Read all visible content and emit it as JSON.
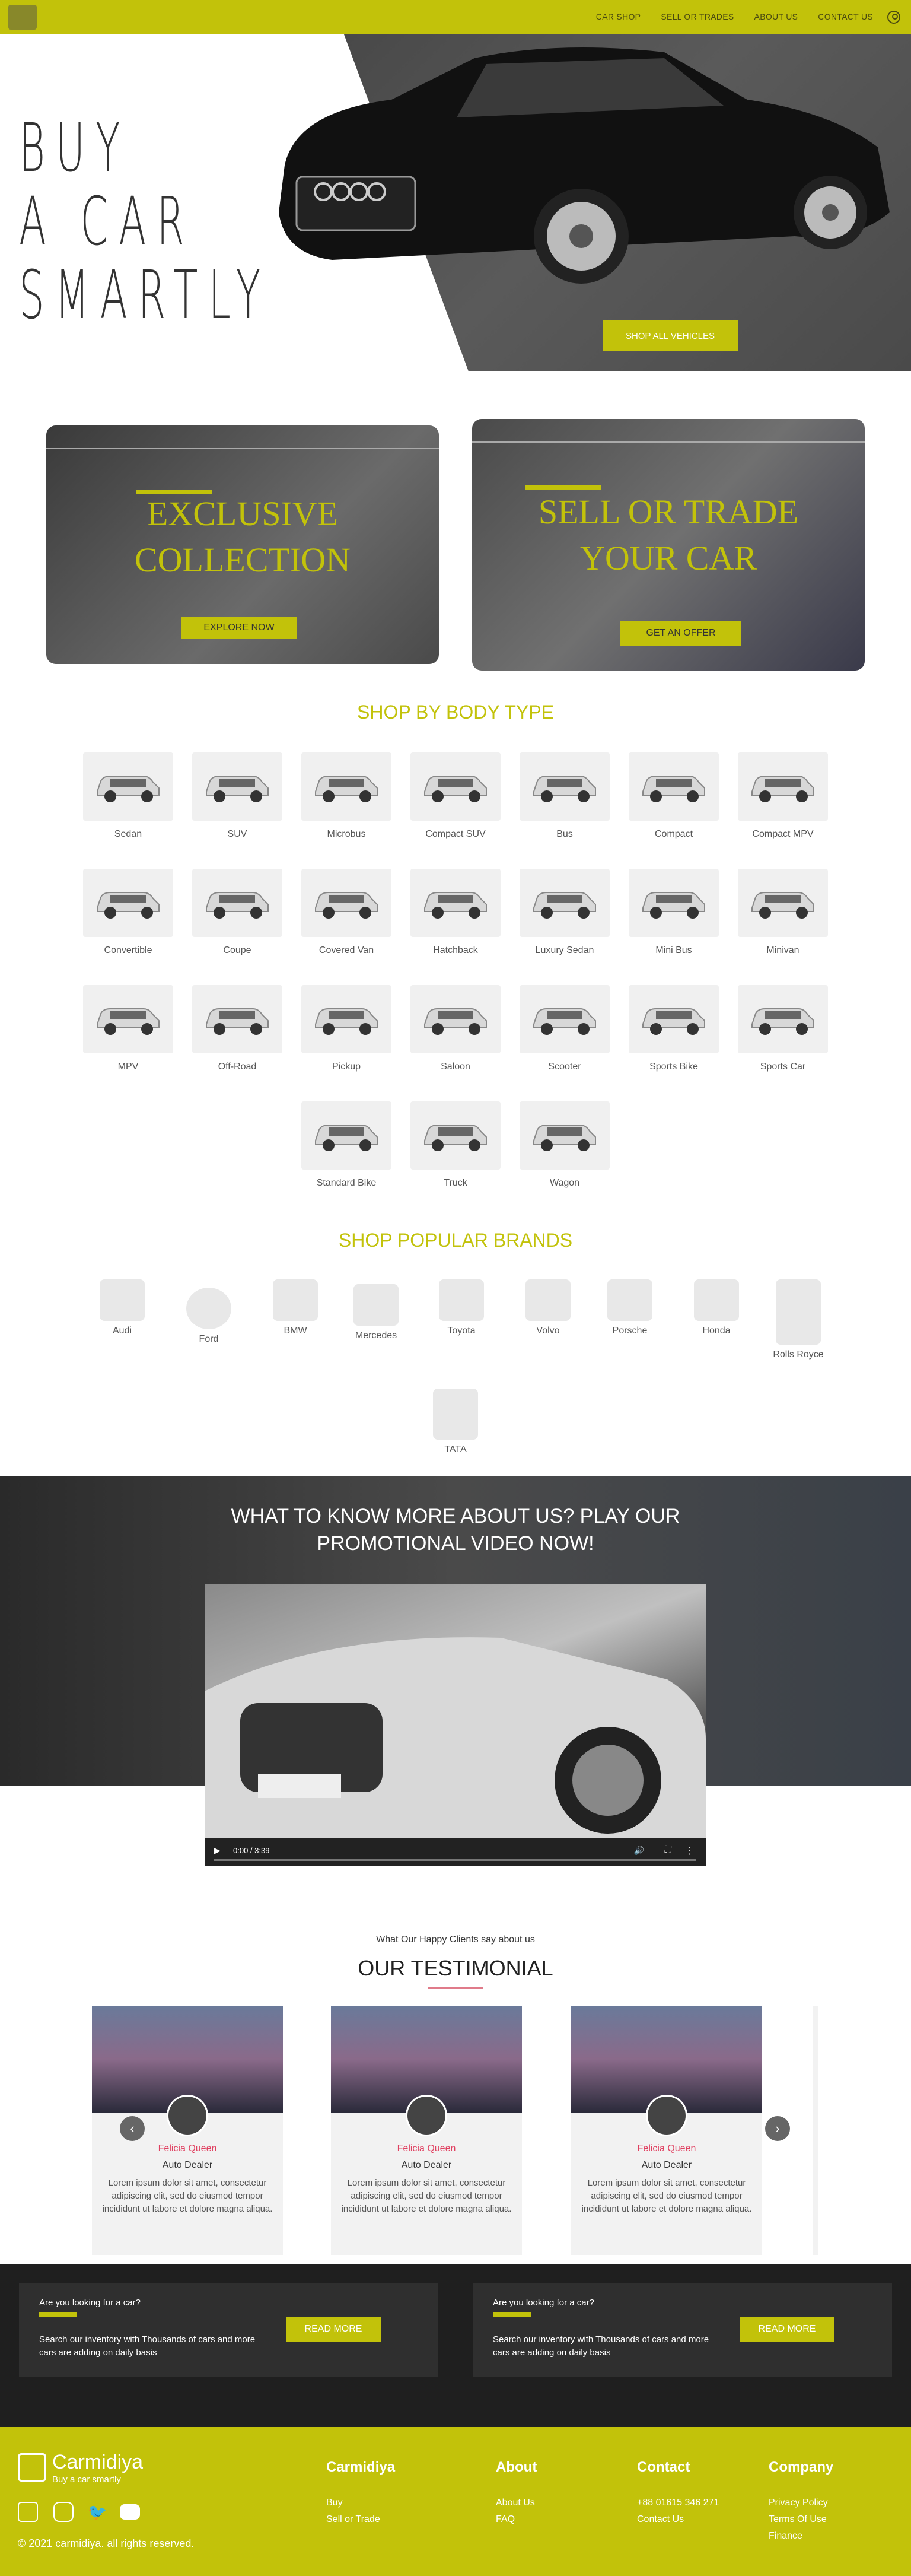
{
  "nav": {
    "links": [
      "CAR SHOP",
      "SELL OR TRADES",
      "ABOUT US",
      "CONTACT US"
    ]
  },
  "hero": {
    "title_lines": [
      "BUY",
      "A CAR",
      "SMARTLY"
    ],
    "button": "SHOP ALL VEHICLES"
  },
  "promo": [
    {
      "title_lines": [
        "EXCLUSIVE",
        "COLLECTION"
      ],
      "button": "EXPLORE NOW"
    },
    {
      "title_lines": [
        "SELL OR TRADE",
        "YOUR CAR"
      ],
      "button": "GET AN OFFER"
    }
  ],
  "body_types": {
    "title": "SHOP BY BODY TYPE",
    "items": [
      "Sedan",
      "SUV",
      "Microbus",
      "Compact SUV",
      "Bus",
      "Compact",
      "Compact MPV",
      "Convertible",
      "Coupe",
      "Covered Van",
      "Hatchback",
      "Luxury Sedan",
      "Mini Bus",
      "Minivan",
      "MPV",
      "Off-Road",
      "Pickup",
      "Saloon",
      "Scooter",
      "Sports Bike",
      "Sports Car",
      "Standard Bike",
      "Truck",
      "Wagon"
    ]
  },
  "brands": {
    "title": "SHOP POPULAR BRANDS",
    "items": [
      "Audi",
      "Ford",
      "BMW",
      "Mercedes",
      "Toyota",
      "Volvo",
      "Porsche",
      "Honda",
      "Rolls Royce",
      "TATA"
    ]
  },
  "video": {
    "title_lines": [
      "WHAT TO KNOW MORE ABOUT US? PLAY OUR",
      "PROMOTIONAL VIDEO NOW!"
    ],
    "time": "0:00 / 3:39"
  },
  "testimonials": {
    "subtitle": "What Our Happy Clients say about us",
    "title": "OUR TESTIMONIAL",
    "items": [
      {
        "name": "Felicia Queen",
        "role": "Auto Dealer",
        "text": "Lorem ipsum dolor sit amet, consectetur adipiscing elit, sed do eiusmod tempor incididunt ut labore et dolore magna aliqua."
      },
      {
        "name": "Felicia Queen",
        "role": "Auto Dealer",
        "text": "Lorem ipsum dolor sit amet, consectetur adipiscing elit, sed do eiusmod tempor incididunt ut labore et dolore magna aliqua."
      },
      {
        "name": "Felicia Queen",
        "role": "Auto Dealer",
        "text": "Lorem ipsum dolor sit amet, consectetur adipiscing elit, sed do eiusmod tempor incididunt ut labore et dolore magna aliqua."
      }
    ]
  },
  "cta": [
    {
      "question": "Are you looking for a car?",
      "desc": "Search our inventory with Thousands of cars and more cars are adding on daily basis",
      "button": "READ MORE"
    },
    {
      "question": "Are you looking for a car?",
      "desc": "Search our inventory with Thousands of cars and more cars are adding on daily basis",
      "button": "READ MORE"
    }
  ],
  "footer": {
    "brand": "Carmidiya",
    "tagline": "Buy a car smartly",
    "copyright": "© 2021 carmidiya. all rights reserved.",
    "columns": [
      {
        "heading": "Carmidiya",
        "links": [
          "Buy",
          "Sell or Trade"
        ]
      },
      {
        "heading": "About",
        "links": [
          "About Us",
          "FAQ"
        ]
      },
      {
        "heading": "Contact",
        "links": [
          "+88 01615 346 271",
          "Contact Us"
        ]
      },
      {
        "heading": "Company",
        "links": [
          "Privacy Policy",
          "Terms Of Use",
          "Finance"
        ]
      }
    ],
    "social": [
      "facebook-icon",
      "instagram-icon",
      "twitter-icon",
      "youtube-icon"
    ]
  },
  "colors": {
    "accent": "#c2c20a",
    "dark": "#1f1f1f",
    "pink": "#e04060"
  }
}
